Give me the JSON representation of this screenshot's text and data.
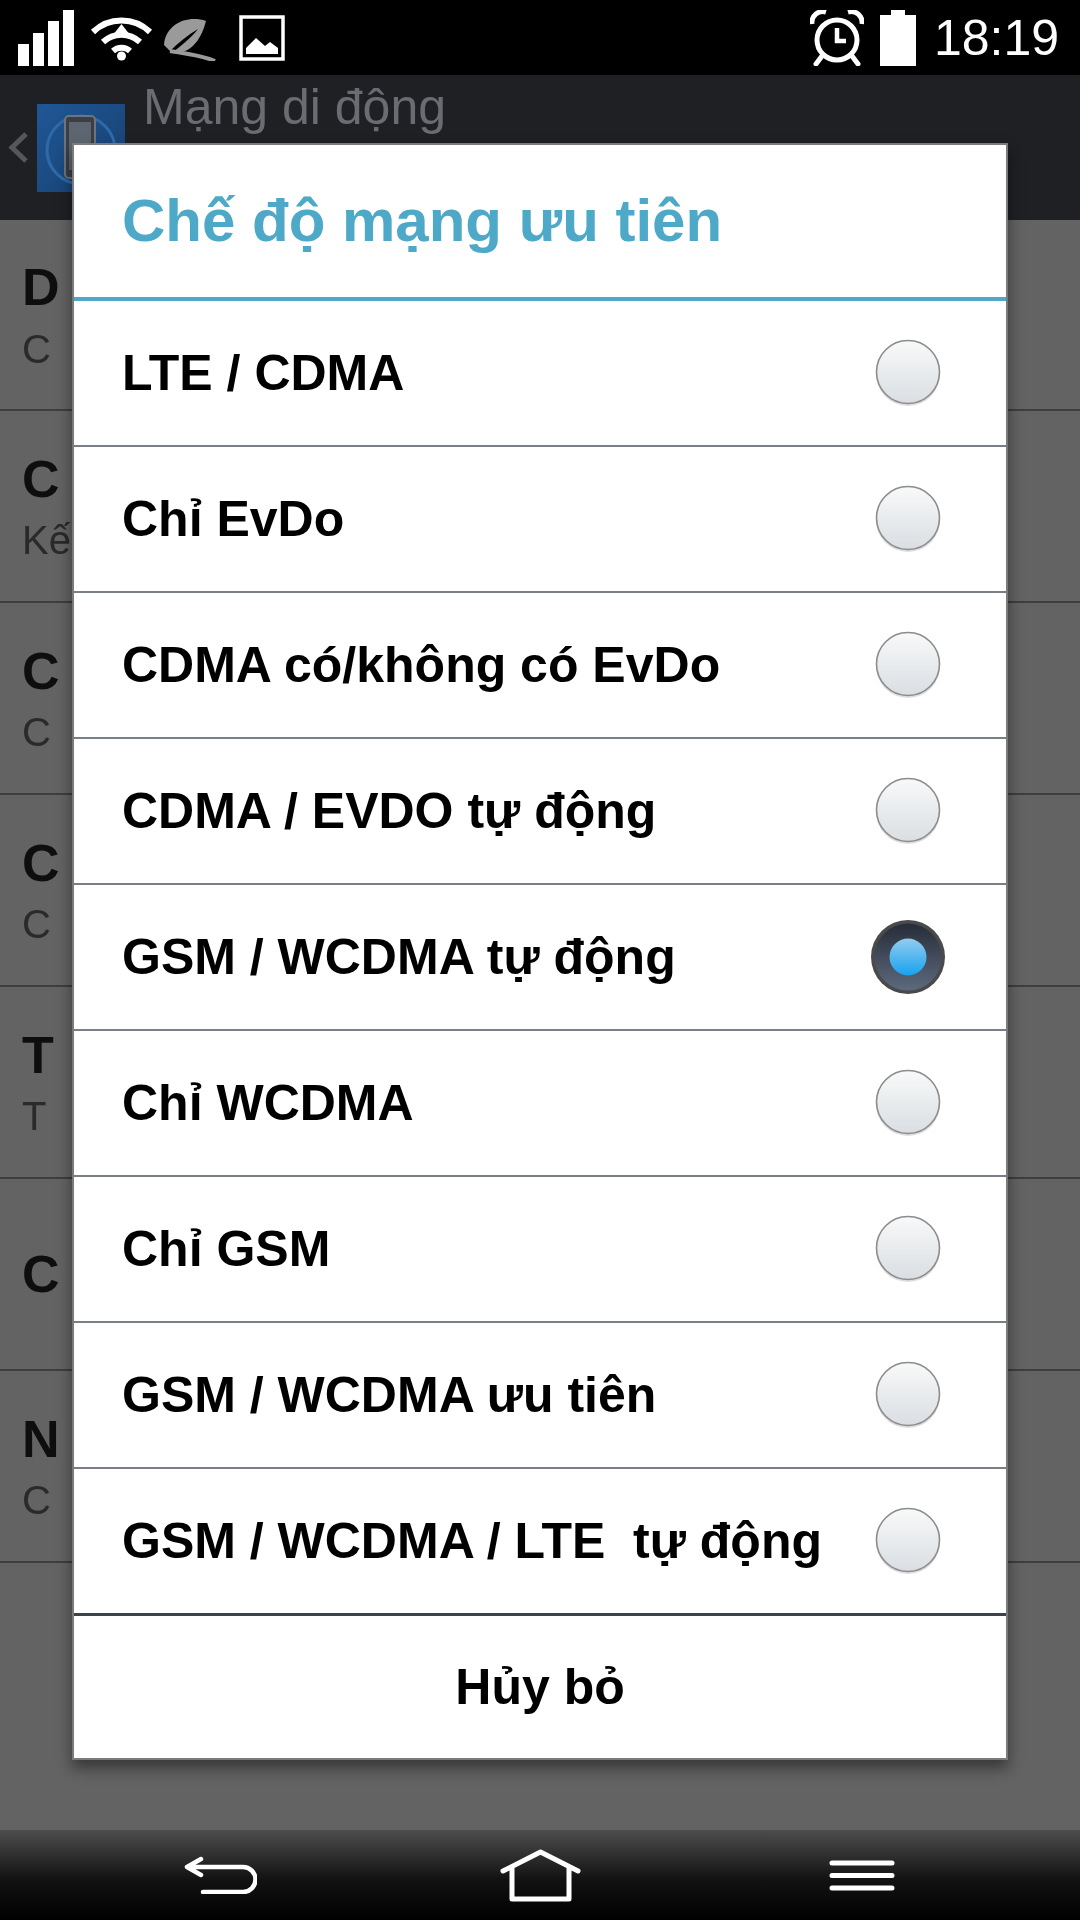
{
  "status_bar": {
    "time": "18:19"
  },
  "app_bar": {
    "title": "Mạng di động"
  },
  "background_list": [
    {
      "title": "D",
      "subtitle": "C"
    },
    {
      "title": "C",
      "subtitle": "Kế"
    },
    {
      "title": "C",
      "subtitle": "C"
    },
    {
      "title": "C",
      "subtitle": "C"
    },
    {
      "title": "T",
      "subtitle": "T"
    },
    {
      "title": "C"
    },
    {
      "title": "N",
      "subtitle": "C"
    }
  ],
  "dialog": {
    "title": "Chế độ mạng ưu tiên",
    "options": [
      {
        "label": "LTE / CDMA",
        "selected": false
      },
      {
        "label": "Chỉ EvDo",
        "selected": false
      },
      {
        "label": "CDMA có/không có EvDo",
        "selected": false
      },
      {
        "label": "CDMA / EVDO tự động",
        "selected": false
      },
      {
        "label": "GSM / WCDMA tự động",
        "selected": true
      },
      {
        "label": "Chỉ WCDMA",
        "selected": false
      },
      {
        "label": "Chỉ GSM",
        "selected": false
      },
      {
        "label": "GSM / WCDMA ưu tiên",
        "selected": false
      },
      {
        "label": "GSM / WCDMA / LTE  tự động",
        "selected": false
      }
    ],
    "cancel_button": "Hủy bỏ"
  }
}
